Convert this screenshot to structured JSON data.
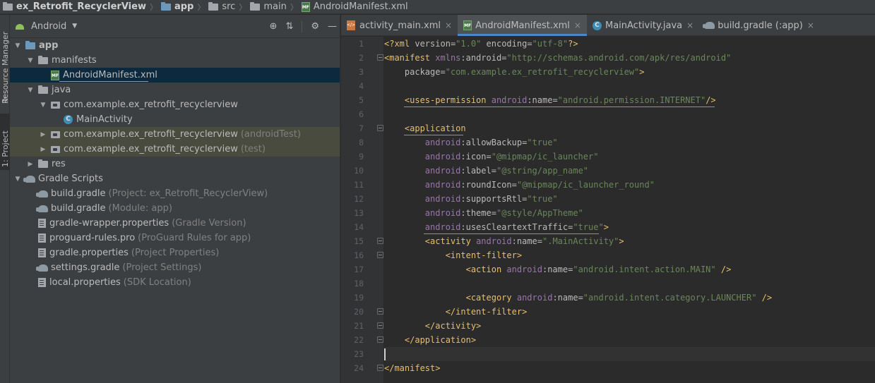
{
  "breadcrumb": [
    {
      "label": "ex_Retrofit_RecyclerView",
      "icon": "folder-icon"
    },
    {
      "label": "app",
      "icon": "module-folder-icon"
    },
    {
      "label": "src",
      "icon": "folder-icon"
    },
    {
      "label": "main",
      "icon": "folder-icon"
    },
    {
      "label": "AndroidManifest.xml",
      "icon": "manifest-file-icon"
    }
  ],
  "toolwindows": {
    "resource_manager": "Resource Manager",
    "project": "1: Project"
  },
  "project_panel": {
    "view_mode": "Android",
    "tree": [
      {
        "label": "app",
        "suffix": "",
        "icon": "module-folder-icon",
        "depth": 0,
        "expanded": true
      },
      {
        "label": "manifests",
        "suffix": "",
        "icon": "folder-icon",
        "depth": 1,
        "expanded": true
      },
      {
        "label": "AndroidManifest.xml",
        "suffix": "",
        "icon": "manifest-file-icon",
        "depth": 2,
        "selected": true
      },
      {
        "label": "java",
        "suffix": "",
        "icon": "folder-icon",
        "depth": 1,
        "expanded": true
      },
      {
        "label": "com.example.ex_retrofit_recyclerview",
        "suffix": "",
        "icon": "package-icon",
        "depth": 2,
        "expanded": true
      },
      {
        "label": "MainActivity",
        "suffix": "",
        "icon": "class-icon",
        "depth": 3
      },
      {
        "label": "com.example.ex_retrofit_recyclerview",
        "suffix": "(androidTest)",
        "icon": "package-icon",
        "depth": 2,
        "expanded": false,
        "test": true
      },
      {
        "label": "com.example.ex_retrofit_recyclerview",
        "suffix": "(test)",
        "icon": "package-icon",
        "depth": 2,
        "expanded": false,
        "test": true
      },
      {
        "label": "res",
        "suffix": "",
        "icon": "folder-icon",
        "depth": 1,
        "expanded": false
      },
      {
        "label": "Gradle Scripts",
        "suffix": "",
        "icon": "gradle-icon",
        "depth": 0,
        "expanded": true
      },
      {
        "label": "build.gradle",
        "suffix": "(Project: ex_Retrofit_RecyclerView)",
        "icon": "gradle-icon",
        "depth": 1
      },
      {
        "label": "build.gradle",
        "suffix": "(Module: app)",
        "icon": "gradle-icon",
        "depth": 1
      },
      {
        "label": "gradle-wrapper.properties",
        "suffix": "(Gradle Version)",
        "icon": "properties-file-icon",
        "depth": 1
      },
      {
        "label": "proguard-rules.pro",
        "suffix": "(ProGuard Rules for app)",
        "icon": "properties-file-icon",
        "depth": 1
      },
      {
        "label": "gradle.properties",
        "suffix": "(Project Properties)",
        "icon": "properties-file-icon",
        "depth": 1
      },
      {
        "label": "settings.gradle",
        "suffix": "(Project Settings)",
        "icon": "gradle-icon",
        "depth": 1
      },
      {
        "label": "local.properties",
        "suffix": "(SDK Location)",
        "icon": "properties-file-icon",
        "depth": 1
      }
    ]
  },
  "editor_tabs": [
    {
      "label": "activity_main.xml",
      "icon": "xml-file-icon",
      "active": false
    },
    {
      "label": "AndroidManifest.xml",
      "icon": "manifest-file-icon",
      "active": true
    },
    {
      "label": "MainActivity.java",
      "icon": "class-icon",
      "active": false
    },
    {
      "label": "build.gradle (:app)",
      "icon": "gradle-icon",
      "active": false
    }
  ],
  "editor": {
    "lines": [
      "<?xml version=\"1.0\" encoding=\"utf-8\"?>",
      "<manifest xmlns:android=\"http://schemas.android.com/apk/res/android\"",
      "    package=\"com.example.ex_retrofit_recyclerview\">",
      "",
      "    <uses-permission android:name=\"android.permission.INTERNET\"/>",
      "",
      "    <application",
      "        android:allowBackup=\"true\"",
      "        android:icon=\"@mipmap/ic_launcher\"",
      "        android:label=\"@string/app_name\"",
      "        android:roundIcon=\"@mipmap/ic_launcher_round\"",
      "        android:supportsRtl=\"true\"",
      "        android:theme=\"@style/AppTheme\"",
      "        android:usesCleartextTraffic=\"true\">",
      "        <activity android:name=\".MainActivity\">",
      "            <intent-filter>",
      "                <action android:name=\"android.intent.action.MAIN\" />",
      "",
      "                <category android:name=\"android.intent.category.LAUNCHER\" />",
      "            </intent-filter>",
      "        </activity>",
      "    </application>",
      "",
      "</manifest>"
    ],
    "caret_line": 23
  },
  "colors": {
    "tag": "#e8bf6a",
    "namespace": "#9876aa",
    "value": "#6a8759",
    "attr": "#bababa",
    "accent": "#4a88c7"
  }
}
